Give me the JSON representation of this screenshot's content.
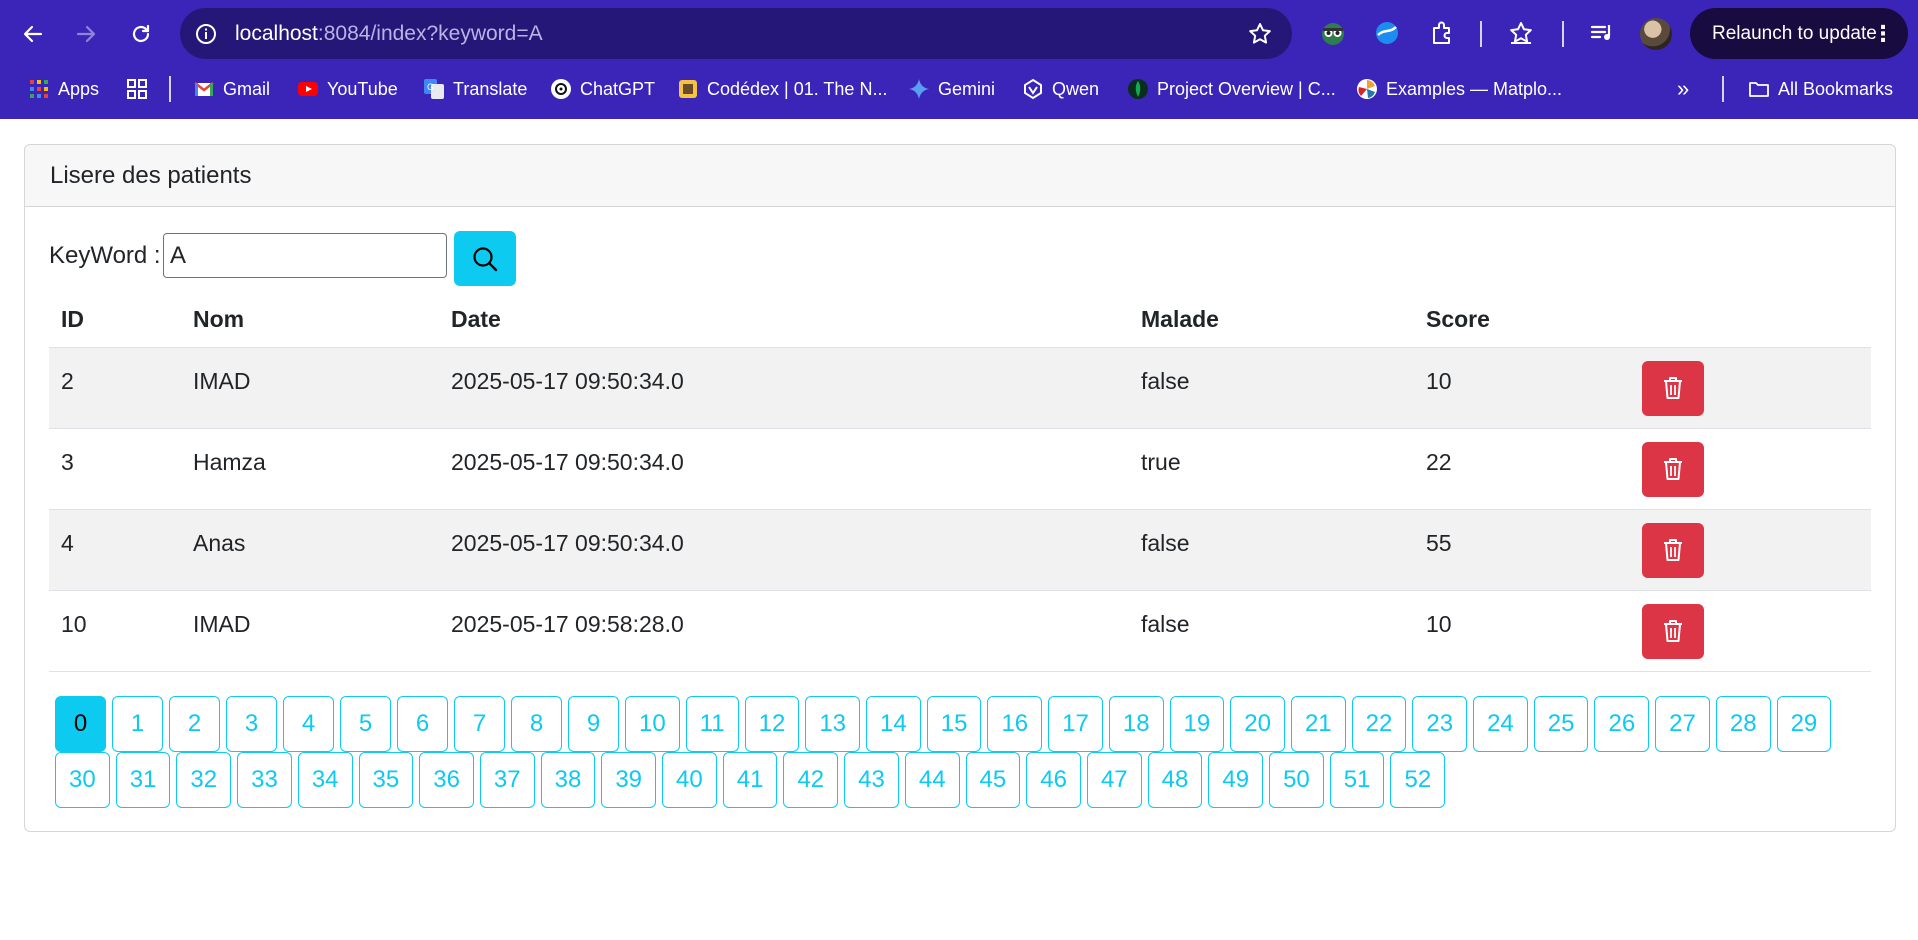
{
  "browser": {
    "url_host": "localhost",
    "url_rest": ":8084/index?keyword=A",
    "relaunch_label": "Relaunch to update",
    "bookmarks": [
      {
        "label": "Apps",
        "icon": "apps-grid-icon"
      },
      {
        "label": "",
        "icon": "tab-groups-icon"
      },
      {
        "label": "Gmail",
        "icon": "gmail-icon"
      },
      {
        "label": "YouTube",
        "icon": "youtube-icon"
      },
      {
        "label": "Translate",
        "icon": "translate-icon"
      },
      {
        "label": "ChatGPT",
        "icon": "chatgpt-icon"
      },
      {
        "label": "Codédex | 01. The N...",
        "icon": "codedex-icon"
      },
      {
        "label": "Gemini",
        "icon": "gemini-icon"
      },
      {
        "label": "Qwen",
        "icon": "qwen-icon"
      },
      {
        "label": "Project Overview | C...",
        "icon": "mongodb-icon"
      },
      {
        "label": "Examples — Matplo...",
        "icon": "matplotlib-icon"
      }
    ],
    "all_bookmarks_label": "All Bookmarks"
  },
  "page": {
    "card_title": "Lisere des patients",
    "search": {
      "label": "KeyWord :",
      "value": "A"
    },
    "table": {
      "headers": [
        "ID",
        "Nom",
        "Date",
        "Malade",
        "Score"
      ],
      "rows": [
        {
          "id": "2",
          "nom": "IMAD",
          "date": "2025-05-17 09:50:34.0",
          "malade": "false",
          "score": "10"
        },
        {
          "id": "3",
          "nom": "Hamza",
          "date": "2025-05-17 09:50:34.0",
          "malade": "true",
          "score": "22"
        },
        {
          "id": "4",
          "nom": "Anas",
          "date": "2025-05-17 09:50:34.0",
          "malade": "false",
          "score": "55"
        },
        {
          "id": "10",
          "nom": "IMAD",
          "date": "2025-05-17 09:58:28.0",
          "malade": "false",
          "score": "10"
        }
      ]
    },
    "pagination": {
      "current": "0",
      "pages": [
        "0",
        "1",
        "2",
        "3",
        "4",
        "5",
        "6",
        "7",
        "8",
        "9",
        "10",
        "11",
        "12",
        "13",
        "14",
        "15",
        "16",
        "17",
        "18",
        "19",
        "20",
        "21",
        "22",
        "23",
        "24",
        "25",
        "26",
        "27",
        "28",
        "29",
        "30",
        "31",
        "32",
        "33",
        "34",
        "35",
        "36",
        "37",
        "38",
        "39",
        "40",
        "41",
        "42",
        "43",
        "44",
        "45",
        "46",
        "47",
        "48",
        "49",
        "50",
        "51",
        "52"
      ]
    }
  },
  "colors": {
    "chrome": "#3b25b8",
    "info_button": "#0dcaf0",
    "danger_button": "#dc3545"
  }
}
